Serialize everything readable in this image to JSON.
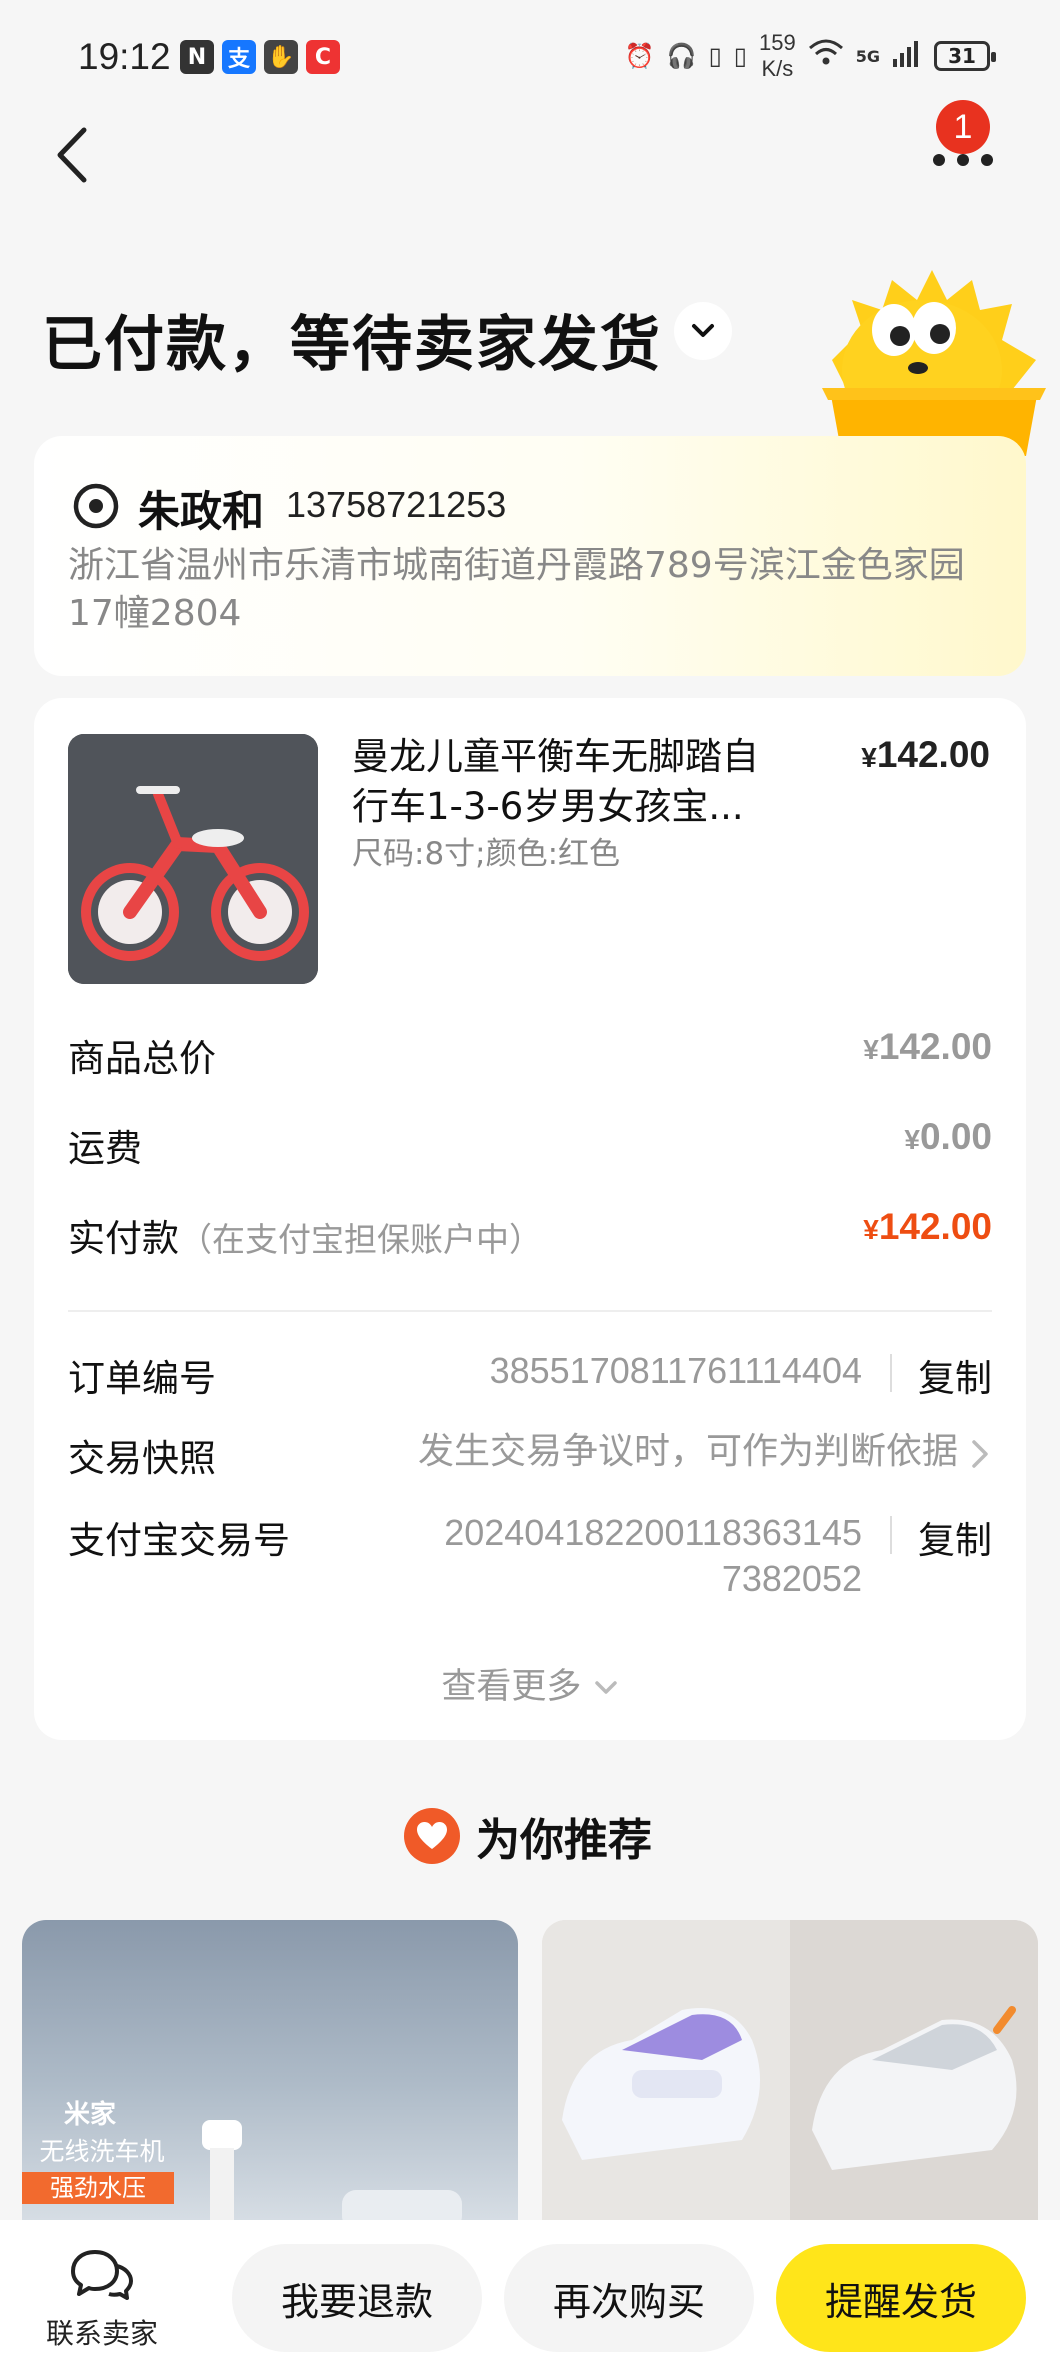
{
  "status_bar": {
    "time": "19:12",
    "net_speed_value": "159",
    "net_speed_unit": "K/s",
    "network": "5G",
    "battery": "31"
  },
  "nav": {
    "notification_count": "1"
  },
  "order_status": {
    "title": "已付款，等待卖家发货"
  },
  "address": {
    "name": "朱政和",
    "phone": "13758721253",
    "detail": "浙江省温州市乐清市城南街道丹霞路789号滨江金色家园17幢2804"
  },
  "product": {
    "title": "曼龙儿童平衡车无脚踏自行车1-3-6岁男女孩宝...",
    "spec": "尺码:8寸;颜色:红色",
    "currency": "¥",
    "price": "142.00"
  },
  "summary": {
    "subtotal_label": "商品总价",
    "subtotal": "142.00",
    "shipping_label": "运费",
    "shipping": "0.00",
    "paid_label": "实付款",
    "paid_note": "（在支付宝担保账户中）",
    "paid": "142.00"
  },
  "order_info": {
    "order_no_label": "订单编号",
    "order_no": "3855170811761114404",
    "copy_label": "复制",
    "snapshot_label": "交易快照",
    "snapshot_text": "发生交易争议时，可作为判断依据",
    "alipay_label": "支付宝交易号",
    "alipay_no_line1": "20240418220011836314​5",
    "alipay_no_line2": "7382052",
    "see_more": "查看更多"
  },
  "recommend": {
    "title": "为你推荐",
    "items": [
      {
        "brand": "米家",
        "subtitle": "无线洗车机",
        "tag": "强劲水压"
      },
      {
        "brand": ""
      }
    ]
  },
  "bottom_bar": {
    "contact_label": "联系卖家",
    "refund_label": "我要退款",
    "rebuy_label": "再次购买",
    "remind_label": "提醒发货"
  },
  "colors": {
    "accent_red": "#ee4d12",
    "remind_yellow": "#ffe51a",
    "badge_red": "#e8321f"
  }
}
